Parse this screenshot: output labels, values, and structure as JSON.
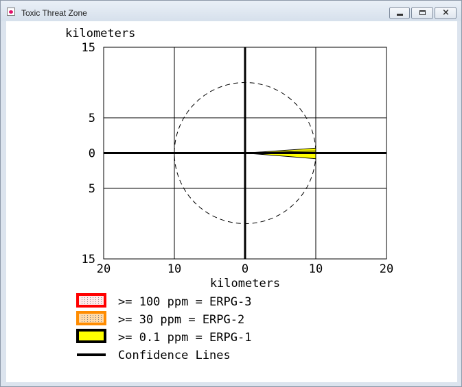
{
  "window": {
    "title": "Toxic Threat Zone",
    "controls": {
      "minimize": "minimize",
      "maximize": "maximize",
      "close": "×"
    }
  },
  "chart_data": {
    "type": "area",
    "ylabel": "kilometers",
    "xlabel": "kilometers",
    "xlim": [
      -20,
      20
    ],
    "ylim": [
      -15,
      15
    ],
    "x_ticks": [
      {
        "value": -20,
        "label": "20"
      },
      {
        "value": -10,
        "label": "10"
      },
      {
        "value": 0,
        "label": "0"
      },
      {
        "value": 10,
        "label": "10"
      },
      {
        "value": 20,
        "label": "20"
      }
    ],
    "y_ticks": [
      {
        "value": 15,
        "label": "15"
      },
      {
        "value": 5,
        "label": "5"
      },
      {
        "value": 0,
        "label": "0"
      },
      {
        "value": -5,
        "label": "5"
      },
      {
        "value": -15,
        "label": "15"
      }
    ],
    "grid": true,
    "circle": {
      "center": [
        0,
        0
      ],
      "radius_km": 10,
      "style": "dashed"
    },
    "threat_zone": {
      "name": ">= 0.1 ppm = ERPG-1",
      "color": "#ffff00",
      "points": [
        [
          0,
          0
        ],
        [
          10,
          0.7
        ],
        [
          10,
          -0.8
        ]
      ]
    },
    "confidence_lines": [
      [
        [
          0,
          0
        ],
        [
          10,
          0.3
        ]
      ],
      [
        [
          0,
          0
        ],
        [
          10,
          -0.1
        ]
      ]
    ]
  },
  "legend": [
    {
      "label": ">= 100 ppm = ERPG-3",
      "fill": "#ffe8e8",
      "border": "#ff0000",
      "dotted": true
    },
    {
      "label": ">= 30 ppm = ERPG-2",
      "fill": "#ffd9a8",
      "border": "#ff8c00",
      "dotted": true
    },
    {
      "label": ">= 0.1 ppm = ERPG-1",
      "fill": "#ffff00",
      "border": "#000000",
      "dotted": false
    },
    {
      "label": "Confidence Lines",
      "line": "#000000"
    }
  ]
}
